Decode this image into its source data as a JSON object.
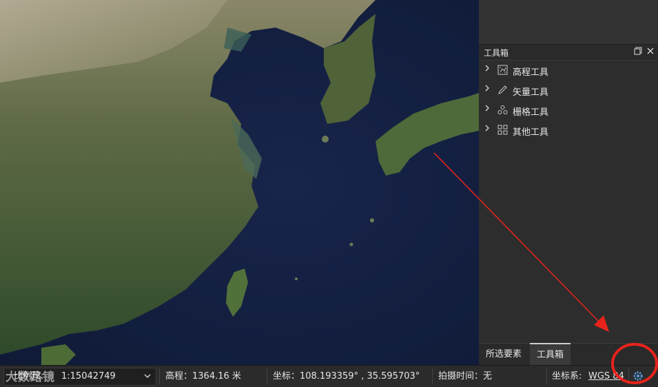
{
  "toolbox": {
    "title": "工具箱",
    "items": [
      {
        "label": "高程工具",
        "icon": "elevation-grid-icon"
      },
      {
        "label": "矢量工具",
        "icon": "pencil-icon"
      },
      {
        "label": "栅格工具",
        "icon": "raster-nodes-icon"
      },
      {
        "label": "其他工具",
        "icon": "grid-squares-icon"
      }
    ]
  },
  "tabs": [
    "所选要素",
    "工具箱"
  ],
  "status": {
    "scale_label": "比例尺:",
    "scale_value": "1:15042749",
    "elevation": "高程：1364.16 米",
    "coordinates": "坐标：108.193359° , 35.595703°",
    "capture_time": "拍摄时间：无",
    "crs_label": "坐标系:",
    "crs_value": "WGS 84"
  },
  "watermark": "大数路镜",
  "colors": {
    "annotation_red": "#e8231b",
    "accent_blue": "#5aa0e6"
  }
}
